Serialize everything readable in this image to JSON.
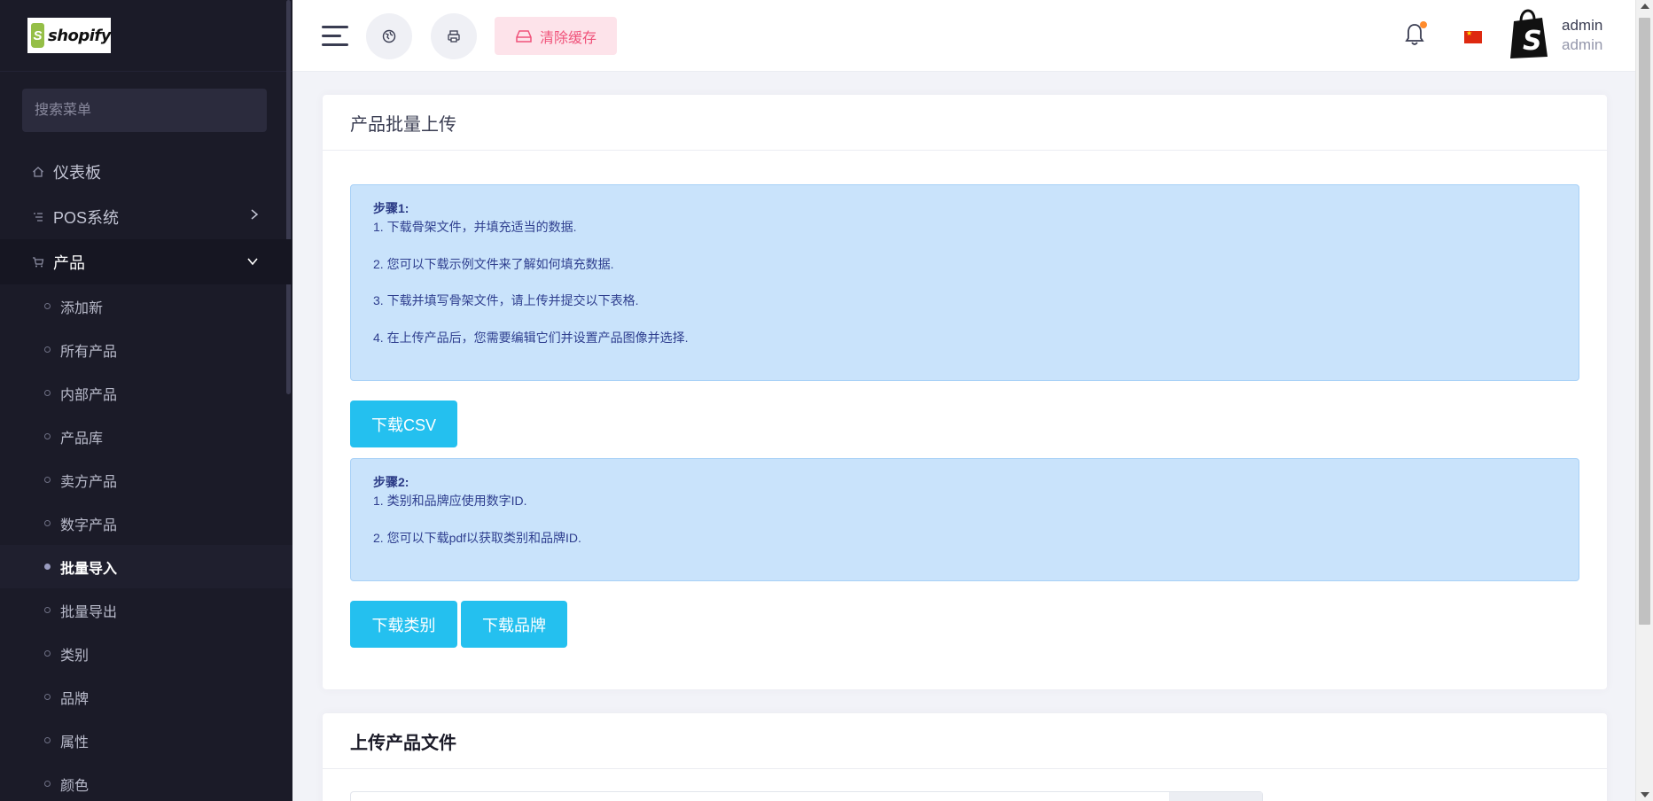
{
  "sidebar": {
    "logo_text": "shopify",
    "search_placeholder": "搜索菜单",
    "items": [
      {
        "label": "仪表板",
        "icon": "home-icon"
      },
      {
        "label": "POS系统",
        "icon": "list-icon"
      },
      {
        "label": "产品",
        "icon": "cart-icon"
      }
    ],
    "products_sub": [
      {
        "label": "添加新"
      },
      {
        "label": "所有产品"
      },
      {
        "label": "内部产品"
      },
      {
        "label": "产品库"
      },
      {
        "label": "卖方产品"
      },
      {
        "label": "数字产品"
      },
      {
        "label": "批量导入"
      },
      {
        "label": "批量导出"
      },
      {
        "label": "类别"
      },
      {
        "label": "品牌"
      },
      {
        "label": "属性"
      },
      {
        "label": "颜色"
      }
    ]
  },
  "header": {
    "clear_cache_label": "清除缓存",
    "user_name": "admin",
    "user_role": "admin",
    "notification_dot_color": "#ff8b2c"
  },
  "main": {
    "bulk_upload": {
      "title": "产品批量上传",
      "step1": {
        "heading": "步骤1:",
        "lines": [
          "1. 下载骨架文件，并填充适当的数据.",
          "2. 您可以下载示例文件来了解如何填充数据.",
          "3. 下载并填写骨架文件，请上传并提交以下表格.",
          "4. 在上传产品后，您需要编辑它们并设置产品图像并选择."
        ]
      },
      "download_csv_label": "下载CSV",
      "step2": {
        "heading": "步骤2:",
        "lines": [
          "1. 类别和品牌应使用数字ID.",
          "2. 您可以下载pdf以获取类别和品牌ID."
        ]
      },
      "download_category_label": "下载类别",
      "download_brand_label": "下载品牌"
    },
    "upload_file": {
      "title": "上传产品文件"
    }
  }
}
